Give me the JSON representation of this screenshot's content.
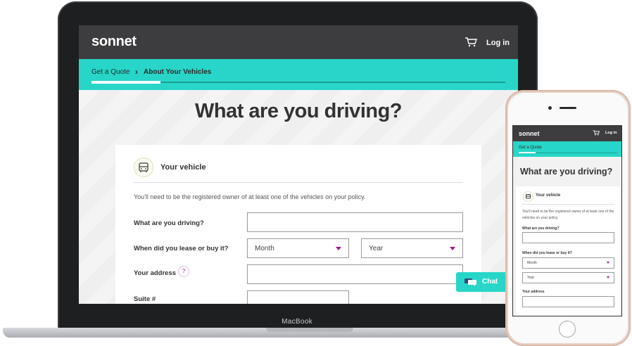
{
  "laptop": {
    "brand": "MacBook",
    "header": {
      "logo": "sonnet",
      "cart_icon": "cart-icon",
      "login_label": "Log in"
    },
    "breadcrumb": {
      "step1": "Get a Quote",
      "separator": "›",
      "step2": "About Your Vehicles",
      "progress_fraction": 0.17
    },
    "page": {
      "title": "What are you driving?"
    },
    "card": {
      "section_icon": "car-icon",
      "section_title": "Your vehicle",
      "intro": "You'll need to be the registered owner of at least one of the vehicles on your policy.",
      "fields": {
        "driving_label": "What are you driving?",
        "lease_label": "When did you lease or buy it?",
        "month_value": "Month",
        "year_value": "Year",
        "address_label": "Your address",
        "address_help": "?",
        "suite_label": "Suite #"
      }
    },
    "chat": {
      "icon": "chat-bubbles-icon",
      "label": "Chat"
    }
  },
  "phone": {
    "header": {
      "logo": "sonnet",
      "cart_icon": "cart-icon",
      "login_label": "Log in"
    },
    "breadcrumb": {
      "step1": "Get a Quote",
      "progress_fraction": 0.17
    },
    "page": {
      "title": "What are you driving?"
    },
    "card": {
      "section_icon": "car-icon",
      "section_title": "Your vehicle",
      "intro": "You'll need to be the registered owner of at least one of the vehicles on your policy.",
      "fields": {
        "driving_label": "What are you driving?",
        "lease_label": "When did you lease or buy it?",
        "month_value": "Month",
        "year_value": "Year",
        "address_label": "Your address"
      }
    }
  },
  "colors": {
    "accent": "#27d6c8",
    "header": "#3d3d3f",
    "caret": "#a0198c"
  }
}
